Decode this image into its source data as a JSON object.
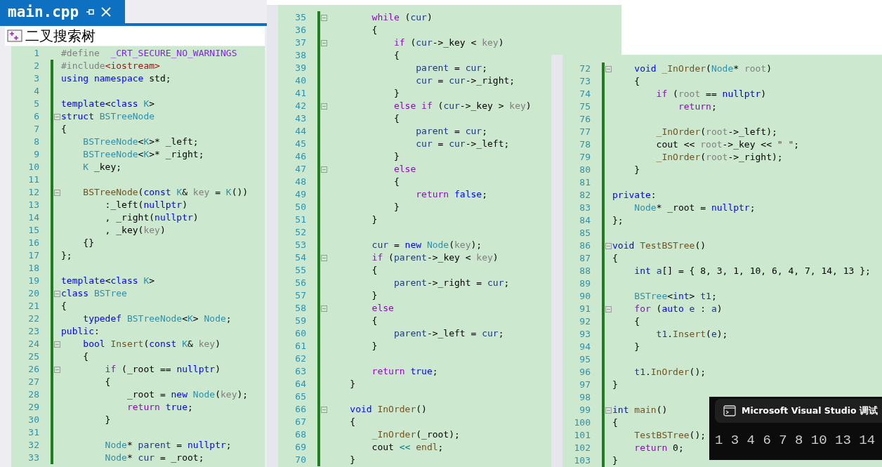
{
  "tab": {
    "title": "main.cpp"
  },
  "navigation_bar": {
    "scope": "二叉搜索树"
  },
  "panels": [
    {
      "lines": [
        {
          "number": "1",
          "changed": false,
          "fold": false,
          "code": [
            {
              "text": "#define  ",
              "kind": "pp"
            },
            {
              "text": "_CRT_SECURE_NO_WARNINGS",
              "kind": "macro"
            }
          ]
        },
        {
          "number": "2",
          "changed": true,
          "fold": false,
          "code": [
            {
              "text": "#include",
              "kind": "pp"
            },
            {
              "text": "<iostream>",
              "kind": "str"
            }
          ]
        },
        {
          "number": "3",
          "changed": true,
          "fold": false,
          "code": [
            {
              "text": "using namespace",
              "kind": "kw"
            },
            {
              "text": " std;",
              "kind": "plain"
            }
          ]
        },
        {
          "number": "4",
          "changed": true,
          "fold": false
        },
        {
          "number": "5",
          "changed": true,
          "fold": false,
          "code": [
            {
              "text": "template",
              "kind": "kw"
            },
            {
              "text": "<",
              "kind": "plain"
            },
            {
              "text": "class ",
              "kind": "kw"
            },
            {
              "text": "K",
              "kind": "type"
            },
            {
              "text": ">",
              "kind": "plain"
            }
          ]
        },
        {
          "number": "6",
          "changed": true,
          "fold": true,
          "code": [
            {
              "text": "struct ",
              "kind": "kw"
            },
            {
              "text": "BSTreeNode",
              "kind": "type"
            }
          ]
        },
        {
          "number": "7",
          "changed": true,
          "fold": false,
          "code": [
            {
              "text": "{",
              "kind": "plain"
            }
          ]
        },
        {
          "number": "8",
          "changed": true,
          "fold": false,
          "code": [
            {
              "text": "    BSTreeNode",
              "kind": "type"
            },
            {
              "text": "<",
              "kind": "plain"
            },
            {
              "text": "K",
              "kind": "type"
            },
            {
              "text": ">* _left;",
              "kind": "plain"
            }
          ]
        },
        {
          "number": "9",
          "changed": true,
          "fold": false,
          "code": [
            {
              "text": "    BSTreeNode",
              "kind": "type"
            },
            {
              "text": "<",
              "kind": "plain"
            },
            {
              "text": "K",
              "kind": "type"
            },
            {
              "text": ">* _right;",
              "kind": "plain"
            }
          ]
        },
        {
          "number": "10",
          "changed": true,
          "fold": false,
          "code": [
            {
              "text": "    K",
              "kind": "type"
            },
            {
              "text": " _key;",
              "kind": "plain"
            }
          ]
        },
        {
          "number": "11",
          "changed": true,
          "fold": false
        },
        {
          "number": "12",
          "changed": true,
          "fold": true,
          "code": [
            {
              "text": "    BSTreeNode",
              "kind": "fn"
            },
            {
              "text": "(",
              "kind": "plain"
            },
            {
              "text": "const ",
              "kind": "kw"
            },
            {
              "text": "K",
              "kind": "type"
            },
            {
              "text": "& ",
              "kind": "plain"
            },
            {
              "text": "key",
              "kind": "param"
            },
            {
              "text": " = ",
              "kind": "plain"
            },
            {
              "text": "K",
              "kind": "type"
            },
            {
              "text": "())",
              "kind": "plain"
            }
          ]
        },
        {
          "number": "13",
          "changed": true,
          "fold": false,
          "code": [
            {
              "text": "        :_left(",
              "kind": "plain"
            },
            {
              "text": "nullptr",
              "kind": "kw"
            },
            {
              "text": ")",
              "kind": "plain"
            }
          ]
        },
        {
          "number": "14",
          "changed": true,
          "fold": false,
          "code": [
            {
              "text": "        , _right(",
              "kind": "plain"
            },
            {
              "text": "nullptr",
              "kind": "kw"
            },
            {
              "text": ")",
              "kind": "plain"
            }
          ]
        },
        {
          "number": "15",
          "changed": true,
          "fold": false,
          "code": [
            {
              "text": "        , _key(",
              "kind": "plain"
            },
            {
              "text": "key",
              "kind": "param"
            },
            {
              "text": ")",
              "kind": "plain"
            }
          ]
        },
        {
          "number": "16",
          "changed": true,
          "fold": false,
          "code": [
            {
              "text": "    {}",
              "kind": "plain"
            }
          ]
        },
        {
          "number": "17",
          "changed": true,
          "fold": false,
          "code": [
            {
              "text": "};",
              "kind": "plain"
            }
          ]
        },
        {
          "number": "18",
          "changed": true,
          "fold": false
        },
        {
          "number": "19",
          "changed": true,
          "fold": false,
          "code": [
            {
              "text": "template",
              "kind": "kw"
            },
            {
              "text": "<",
              "kind": "plain"
            },
            {
              "text": "class ",
              "kind": "kw"
            },
            {
              "text": "K",
              "kind": "type"
            },
            {
              "text": ">",
              "kind": "plain"
            }
          ]
        },
        {
          "number": "20",
          "changed": true,
          "fold": true,
          "code": [
            {
              "text": "class ",
              "kind": "kw"
            },
            {
              "text": "BSTree",
              "kind": "type"
            }
          ]
        },
        {
          "number": "21",
          "changed": true,
          "fold": false,
          "code": [
            {
              "text": "{",
              "kind": "plain"
            }
          ]
        },
        {
          "number": "22",
          "changed": true,
          "fold": false,
          "code": [
            {
              "text": "    typedef ",
              "kind": "kw"
            },
            {
              "text": "BSTreeNode",
              "kind": "type"
            },
            {
              "text": "<",
              "kind": "plain"
            },
            {
              "text": "K",
              "kind": "type"
            },
            {
              "text": "> ",
              "kind": "plain"
            },
            {
              "text": "Node",
              "kind": "type"
            },
            {
              "text": ";",
              "kind": "plain"
            }
          ]
        },
        {
          "number": "23",
          "changed": true,
          "fold": false,
          "code": [
            {
              "text": "public",
              "kind": "kw"
            },
            {
              "text": ":",
              "kind": "plain"
            }
          ]
        },
        {
          "number": "24",
          "changed": true,
          "fold": true,
          "code": [
            {
              "text": "    bool ",
              "kind": "kw"
            },
            {
              "text": "Insert",
              "kind": "fn"
            },
            {
              "text": "(",
              "kind": "plain"
            },
            {
              "text": "const ",
              "kind": "kw"
            },
            {
              "text": "K",
              "kind": "type"
            },
            {
              "text": "& ",
              "kind": "plain"
            },
            {
              "text": "key",
              "kind": "param"
            },
            {
              "text": ")",
              "kind": "plain"
            }
          ]
        },
        {
          "number": "25",
          "changed": true,
          "fold": false,
          "code": [
            {
              "text": "    {",
              "kind": "plain"
            }
          ]
        },
        {
          "number": "26",
          "changed": true,
          "fold": true,
          "code": [
            {
              "text": "        if",
              "kind": "ctl"
            },
            {
              "text": " (_root == ",
              "kind": "plain"
            },
            {
              "text": "nullptr",
              "kind": "kw"
            },
            {
              "text": ")",
              "kind": "plain"
            }
          ]
        },
        {
          "number": "27",
          "changed": true,
          "fold": false,
          "code": [
            {
              "text": "        {",
              "kind": "plain"
            }
          ]
        },
        {
          "number": "28",
          "changed": true,
          "fold": false,
          "code": [
            {
              "text": "            _root = ",
              "kind": "plain"
            },
            {
              "text": "new ",
              "kind": "kw"
            },
            {
              "text": "Node",
              "kind": "type"
            },
            {
              "text": "(",
              "kind": "plain"
            },
            {
              "text": "key",
              "kind": "param"
            },
            {
              "text": ");",
              "kind": "plain"
            }
          ]
        },
        {
          "number": "29",
          "changed": true,
          "fold": false,
          "code": [
            {
              "text": "            return ",
              "kind": "ctl"
            },
            {
              "text": "true",
              "kind": "kw"
            },
            {
              "text": ";",
              "kind": "plain"
            }
          ]
        },
        {
          "number": "30",
          "changed": true,
          "fold": false,
          "code": [
            {
              "text": "        }",
              "kind": "plain"
            }
          ]
        },
        {
          "number": "31",
          "changed": true,
          "fold": false
        },
        {
          "number": "32",
          "changed": true,
          "fold": false,
          "code": [
            {
              "text": "        Node",
              "kind": "type"
            },
            {
              "text": "* ",
              "kind": "plain"
            },
            {
              "text": "parent",
              "kind": "var"
            },
            {
              "text": " = ",
              "kind": "plain"
            },
            {
              "text": "nullptr",
              "kind": "kw"
            },
            {
              "text": ";",
              "kind": "plain"
            }
          ]
        },
        {
          "number": "33",
          "changed": true,
          "fold": false,
          "code": [
            {
              "text": "        Node",
              "kind": "type"
            },
            {
              "text": "* ",
              "kind": "plain"
            },
            {
              "text": "cur",
              "kind": "var"
            },
            {
              "text": " = _root;",
              "kind": "plain"
            }
          ]
        }
      ]
    },
    {
      "lines": [
        {
          "number": "35",
          "changed": true,
          "fold": true,
          "code": [
            {
              "text": "        while",
              "kind": "ctl"
            },
            {
              "text": " (",
              "kind": "plain"
            },
            {
              "text": "cur",
              "kind": "var"
            },
            {
              "text": ")",
              "kind": "plain"
            }
          ]
        },
        {
          "number": "36",
          "changed": true,
          "fold": false,
          "code": [
            {
              "text": "        {",
              "kind": "plain"
            }
          ]
        },
        {
          "number": "37",
          "changed": true,
          "fold": true,
          "code": [
            {
              "text": "            if",
              "kind": "ctl"
            },
            {
              "text": " (",
              "kind": "plain"
            },
            {
              "text": "cur",
              "kind": "var"
            },
            {
              "text": "->_key < ",
              "kind": "plain"
            },
            {
              "text": "key",
              "kind": "param"
            },
            {
              "text": ")",
              "kind": "plain"
            }
          ]
        },
        {
          "number": "38",
          "changed": true,
          "fold": false,
          "code": [
            {
              "text": "            {",
              "kind": "plain"
            }
          ]
        },
        {
          "number": "39",
          "changed": true,
          "fold": false,
          "code": [
            {
              "text": "                parent",
              "kind": "var"
            },
            {
              "text": " = ",
              "kind": "plain"
            },
            {
              "text": "cur",
              "kind": "var"
            },
            {
              "text": ";",
              "kind": "plain"
            }
          ]
        },
        {
          "number": "40",
          "changed": true,
          "fold": false,
          "code": [
            {
              "text": "                cur",
              "kind": "var"
            },
            {
              "text": " = ",
              "kind": "plain"
            },
            {
              "text": "cur",
              "kind": "var"
            },
            {
              "text": "->_right;",
              "kind": "plain"
            }
          ]
        },
        {
          "number": "41",
          "changed": true,
          "fold": false,
          "code": [
            {
              "text": "            }",
              "kind": "plain"
            }
          ]
        },
        {
          "number": "42",
          "changed": true,
          "fold": true,
          "code": [
            {
              "text": "            else if",
              "kind": "ctl"
            },
            {
              "text": " (",
              "kind": "plain"
            },
            {
              "text": "cur",
              "kind": "var"
            },
            {
              "text": "->_key > ",
              "kind": "plain"
            },
            {
              "text": "key",
              "kind": "param"
            },
            {
              "text": ")",
              "kind": "plain"
            }
          ]
        },
        {
          "number": "43",
          "changed": true,
          "fold": false,
          "code": [
            {
              "text": "            {",
              "kind": "plain"
            }
          ]
        },
        {
          "number": "44",
          "changed": true,
          "fold": false,
          "code": [
            {
              "text": "                parent",
              "kind": "var"
            },
            {
              "text": " = ",
              "kind": "plain"
            },
            {
              "text": "cur",
              "kind": "var"
            },
            {
              "text": ";",
              "kind": "plain"
            }
          ]
        },
        {
          "number": "45",
          "changed": true,
          "fold": false,
          "code": [
            {
              "text": "                cur",
              "kind": "var"
            },
            {
              "text": " = ",
              "kind": "plain"
            },
            {
              "text": "cur",
              "kind": "var"
            },
            {
              "text": "->_left;",
              "kind": "plain"
            }
          ]
        },
        {
          "number": "46",
          "changed": true,
          "fold": false,
          "code": [
            {
              "text": "            }",
              "kind": "plain"
            }
          ]
        },
        {
          "number": "47",
          "changed": true,
          "fold": true,
          "code": [
            {
              "text": "            else",
              "kind": "ctl"
            }
          ]
        },
        {
          "number": "48",
          "changed": true,
          "fold": false,
          "code": [
            {
              "text": "            {",
              "kind": "plain"
            }
          ]
        },
        {
          "number": "49",
          "changed": true,
          "fold": false,
          "code": [
            {
              "text": "                return ",
              "kind": "ctl"
            },
            {
              "text": "false",
              "kind": "kw"
            },
            {
              "text": ";",
              "kind": "plain"
            }
          ]
        },
        {
          "number": "50",
          "changed": true,
          "fold": false,
          "code": [
            {
              "text": "            }",
              "kind": "plain"
            }
          ]
        },
        {
          "number": "51",
          "changed": true,
          "fold": false,
          "code": [
            {
              "text": "        }",
              "kind": "plain"
            }
          ]
        },
        {
          "number": "52",
          "changed": true,
          "fold": false
        },
        {
          "number": "53",
          "changed": true,
          "fold": false,
          "code": [
            {
              "text": "        cur",
              "kind": "var"
            },
            {
              "text": " = ",
              "kind": "plain"
            },
            {
              "text": "new ",
              "kind": "kw"
            },
            {
              "text": "Node",
              "kind": "type"
            },
            {
              "text": "(",
              "kind": "plain"
            },
            {
              "text": "key",
              "kind": "param"
            },
            {
              "text": ");",
              "kind": "plain"
            }
          ]
        },
        {
          "number": "54",
          "changed": true,
          "fold": true,
          "code": [
            {
              "text": "        if",
              "kind": "ctl"
            },
            {
              "text": " (",
              "kind": "plain"
            },
            {
              "text": "parent",
              "kind": "var"
            },
            {
              "text": "->_key < ",
              "kind": "plain"
            },
            {
              "text": "key",
              "kind": "param"
            },
            {
              "text": ")",
              "kind": "plain"
            }
          ]
        },
        {
          "number": "55",
          "changed": true,
          "fold": false,
          "code": [
            {
              "text": "        {",
              "kind": "plain"
            }
          ]
        },
        {
          "number": "56",
          "changed": true,
          "fold": false,
          "code": [
            {
              "text": "            parent",
              "kind": "var"
            },
            {
              "text": "->_right = ",
              "kind": "plain"
            },
            {
              "text": "cur",
              "kind": "var"
            },
            {
              "text": ";",
              "kind": "plain"
            }
          ]
        },
        {
          "number": "57",
          "changed": true,
          "fold": false,
          "code": [
            {
              "text": "        }",
              "kind": "plain"
            }
          ]
        },
        {
          "number": "58",
          "changed": true,
          "fold": true,
          "code": [
            {
              "text": "        else",
              "kind": "ctl"
            }
          ]
        },
        {
          "number": "59",
          "changed": true,
          "fold": false,
          "code": [
            {
              "text": "        {",
              "kind": "plain"
            }
          ]
        },
        {
          "number": "60",
          "changed": true,
          "fold": false,
          "code": [
            {
              "text": "            parent",
              "kind": "var"
            },
            {
              "text": "->_left = ",
              "kind": "plain"
            },
            {
              "text": "cur",
              "kind": "var"
            },
            {
              "text": ";",
              "kind": "plain"
            }
          ]
        },
        {
          "number": "61",
          "changed": true,
          "fold": false,
          "code": [
            {
              "text": "        }",
              "kind": "plain"
            }
          ]
        },
        {
          "number": "62",
          "changed": true,
          "fold": false
        },
        {
          "number": "63",
          "changed": true,
          "fold": false,
          "code": [
            {
              "text": "        return ",
              "kind": "ctl"
            },
            {
              "text": "true",
              "kind": "kw"
            },
            {
              "text": ";",
              "kind": "plain"
            }
          ]
        },
        {
          "number": "64",
          "changed": true,
          "fold": false,
          "code": [
            {
              "text": "    }",
              "kind": "plain"
            }
          ]
        },
        {
          "number": "65",
          "changed": true,
          "fold": false
        },
        {
          "number": "66",
          "changed": true,
          "fold": true,
          "code": [
            {
              "text": "    void ",
              "kind": "kw"
            },
            {
              "text": "InOrder",
              "kind": "fn"
            },
            {
              "text": "()",
              "kind": "plain"
            }
          ]
        },
        {
          "number": "67",
          "changed": true,
          "fold": false,
          "code": [
            {
              "text": "    {",
              "kind": "plain"
            }
          ]
        },
        {
          "number": "68",
          "changed": true,
          "fold": false,
          "code": [
            {
              "text": "        _InOrder",
              "kind": "fn"
            },
            {
              "text": "(_root);",
              "kind": "plain"
            }
          ]
        },
        {
          "number": "69",
          "changed": true,
          "fold": false,
          "code": [
            {
              "text": "        cout ",
              "kind": "plain"
            },
            {
              "text": "<< ",
              "kind": "op"
            },
            {
              "text": "endl",
              "kind": "fn"
            },
            {
              "text": ";",
              "kind": "plain"
            }
          ]
        },
        {
          "number": "70",
          "changed": true,
          "fold": false,
          "code": [
            {
              "text": "    }",
              "kind": "plain"
            }
          ]
        }
      ]
    },
    {
      "lines": [
        {
          "number": "72",
          "changed": true,
          "fold": true,
          "code": [
            {
              "text": "    void ",
              "kind": "kw"
            },
            {
              "text": "_InOrder",
              "kind": "fn"
            },
            {
              "text": "(",
              "kind": "plain"
            },
            {
              "text": "Node",
              "kind": "type"
            },
            {
              "text": "* ",
              "kind": "plain"
            },
            {
              "text": "root",
              "kind": "param"
            },
            {
              "text": ")",
              "kind": "plain"
            }
          ]
        },
        {
          "number": "73",
          "changed": true,
          "fold": false,
          "code": [
            {
              "text": "    {",
              "kind": "plain"
            }
          ]
        },
        {
          "number": "74",
          "changed": true,
          "fold": false,
          "code": [
            {
              "text": "        if",
              "kind": "ctl"
            },
            {
              "text": " (",
              "kind": "plain"
            },
            {
              "text": "root",
              "kind": "param"
            },
            {
              "text": " == ",
              "kind": "plain"
            },
            {
              "text": "nullptr",
              "kind": "kw"
            },
            {
              "text": ")",
              "kind": "plain"
            }
          ]
        },
        {
          "number": "75",
          "changed": true,
          "fold": false,
          "code": [
            {
              "text": "            return",
              "kind": "ctl"
            },
            {
              "text": ";",
              "kind": "plain"
            }
          ]
        },
        {
          "number": "76",
          "changed": true,
          "fold": false
        },
        {
          "number": "77",
          "changed": true,
          "fold": false,
          "code": [
            {
              "text": "        _InOrder",
              "kind": "fn"
            },
            {
              "text": "(",
              "kind": "plain"
            },
            {
              "text": "root",
              "kind": "param"
            },
            {
              "text": "->_left);",
              "kind": "plain"
            }
          ]
        },
        {
          "number": "78",
          "changed": true,
          "fold": false,
          "code": [
            {
              "text": "        cout << ",
              "kind": "plain"
            },
            {
              "text": "root",
              "kind": "param"
            },
            {
              "text": "->_key << ",
              "kind": "plain"
            },
            {
              "text": "\" \"",
              "kind": "str"
            },
            {
              "text": ";",
              "kind": "plain"
            }
          ]
        },
        {
          "number": "79",
          "changed": true,
          "fold": false,
          "code": [
            {
              "text": "        _InOrder",
              "kind": "fn"
            },
            {
              "text": "(",
              "kind": "plain"
            },
            {
              "text": "root",
              "kind": "param"
            },
            {
              "text": "->_right);",
              "kind": "plain"
            }
          ]
        },
        {
          "number": "80",
          "changed": true,
          "fold": false,
          "code": [
            {
              "text": "    }",
              "kind": "plain"
            }
          ]
        },
        {
          "number": "81",
          "changed": true,
          "fold": false
        },
        {
          "number": "82",
          "changed": true,
          "fold": false,
          "code": [
            {
              "text": "private",
              "kind": "kw"
            },
            {
              "text": ":",
              "kind": "plain"
            }
          ]
        },
        {
          "number": "83",
          "changed": true,
          "fold": false,
          "code": [
            {
              "text": "    Node",
              "kind": "type"
            },
            {
              "text": "* _root = ",
              "kind": "plain"
            },
            {
              "text": "nullptr",
              "kind": "kw"
            },
            {
              "text": ";",
              "kind": "plain"
            }
          ]
        },
        {
          "number": "84",
          "changed": true,
          "fold": false,
          "code": [
            {
              "text": "};",
              "kind": "plain"
            }
          ]
        },
        {
          "number": "85",
          "changed": true,
          "fold": false
        },
        {
          "number": "86",
          "changed": true,
          "fold": true,
          "code": [
            {
              "text": "void ",
              "kind": "kw"
            },
            {
              "text": "TestBSTree",
              "kind": "fn"
            },
            {
              "text": "()",
              "kind": "plain"
            }
          ]
        },
        {
          "number": "87",
          "changed": true,
          "fold": false,
          "code": [
            {
              "text": "{",
              "kind": "plain"
            }
          ]
        },
        {
          "number": "88",
          "changed": true,
          "fold": false,
          "code": [
            {
              "text": "    int ",
              "kind": "kw"
            },
            {
              "text": "a",
              "kind": "var"
            },
            {
              "text": "[] = { 8, 3, 1, 10, 6, 4, 7, 14, 13 };",
              "kind": "plain"
            }
          ]
        },
        {
          "number": "89",
          "changed": true,
          "fold": false
        },
        {
          "number": "90",
          "changed": true,
          "fold": false,
          "code": [
            {
              "text": "    BSTree",
              "kind": "type"
            },
            {
              "text": "<",
              "kind": "plain"
            },
            {
              "text": "int",
              "kind": "kw"
            },
            {
              "text": "> ",
              "kind": "plain"
            },
            {
              "text": "t1",
              "kind": "var"
            },
            {
              "text": ";",
              "kind": "plain"
            }
          ]
        },
        {
          "number": "91",
          "changed": true,
          "fold": true,
          "code": [
            {
              "text": "    for",
              "kind": "ctl"
            },
            {
              "text": " (",
              "kind": "plain"
            },
            {
              "text": "auto ",
              "kind": "kw"
            },
            {
              "text": "e",
              "kind": "var"
            },
            {
              "text": " : ",
              "kind": "plain"
            },
            {
              "text": "a",
              "kind": "var"
            },
            {
              "text": ")",
              "kind": "plain"
            }
          ]
        },
        {
          "number": "92",
          "changed": true,
          "fold": false,
          "code": [
            {
              "text": "    {",
              "kind": "plain"
            }
          ]
        },
        {
          "number": "93",
          "changed": true,
          "fold": false,
          "code": [
            {
              "text": "        t1",
              "kind": "var"
            },
            {
              "text": ".",
              "kind": "plain"
            },
            {
              "text": "Insert",
              "kind": "fn"
            },
            {
              "text": "(",
              "kind": "plain"
            },
            {
              "text": "e",
              "kind": "var"
            },
            {
              "text": ");",
              "kind": "plain"
            }
          ]
        },
        {
          "number": "94",
          "changed": true,
          "fold": false,
          "code": [
            {
              "text": "    }",
              "kind": "plain"
            }
          ]
        },
        {
          "number": "95",
          "changed": true,
          "fold": false
        },
        {
          "number": "96",
          "changed": true,
          "fold": false,
          "code": [
            {
              "text": "    t1",
              "kind": "var"
            },
            {
              "text": ".",
              "kind": "plain"
            },
            {
              "text": "InOrder",
              "kind": "fn"
            },
            {
              "text": "();",
              "kind": "plain"
            }
          ]
        },
        {
          "number": "97",
          "changed": true,
          "fold": false,
          "code": [
            {
              "text": "}",
              "kind": "plain"
            }
          ]
        },
        {
          "number": "98",
          "changed": true,
          "fold": false
        },
        {
          "number": "99",
          "changed": true,
          "fold": true,
          "code": [
            {
              "text": "int ",
              "kind": "kw"
            },
            {
              "text": "main",
              "kind": "fn"
            },
            {
              "text": "()",
              "kind": "plain"
            }
          ]
        },
        {
          "number": "100",
          "changed": true,
          "fold": false,
          "code": [
            {
              "text": "{",
              "kind": "plain"
            }
          ]
        },
        {
          "number": "101",
          "changed": true,
          "fold": false,
          "code": [
            {
              "text": "    TestBSTree",
              "kind": "fn"
            },
            {
              "text": "();",
              "kind": "plain"
            }
          ]
        },
        {
          "number": "102",
          "changed": true,
          "fold": false,
          "code": [
            {
              "text": "    return ",
              "kind": "ctl"
            },
            {
              "text": "0;",
              "kind": "plain"
            }
          ]
        },
        {
          "number": "103",
          "changed": true,
          "fold": false,
          "code": [
            {
              "text": "}",
              "kind": "plain"
            }
          ]
        }
      ]
    }
  ],
  "console": {
    "title": "Microsoft Visual Studio 调试",
    "output": "1 3 4 6 7 8 10 13 14"
  }
}
